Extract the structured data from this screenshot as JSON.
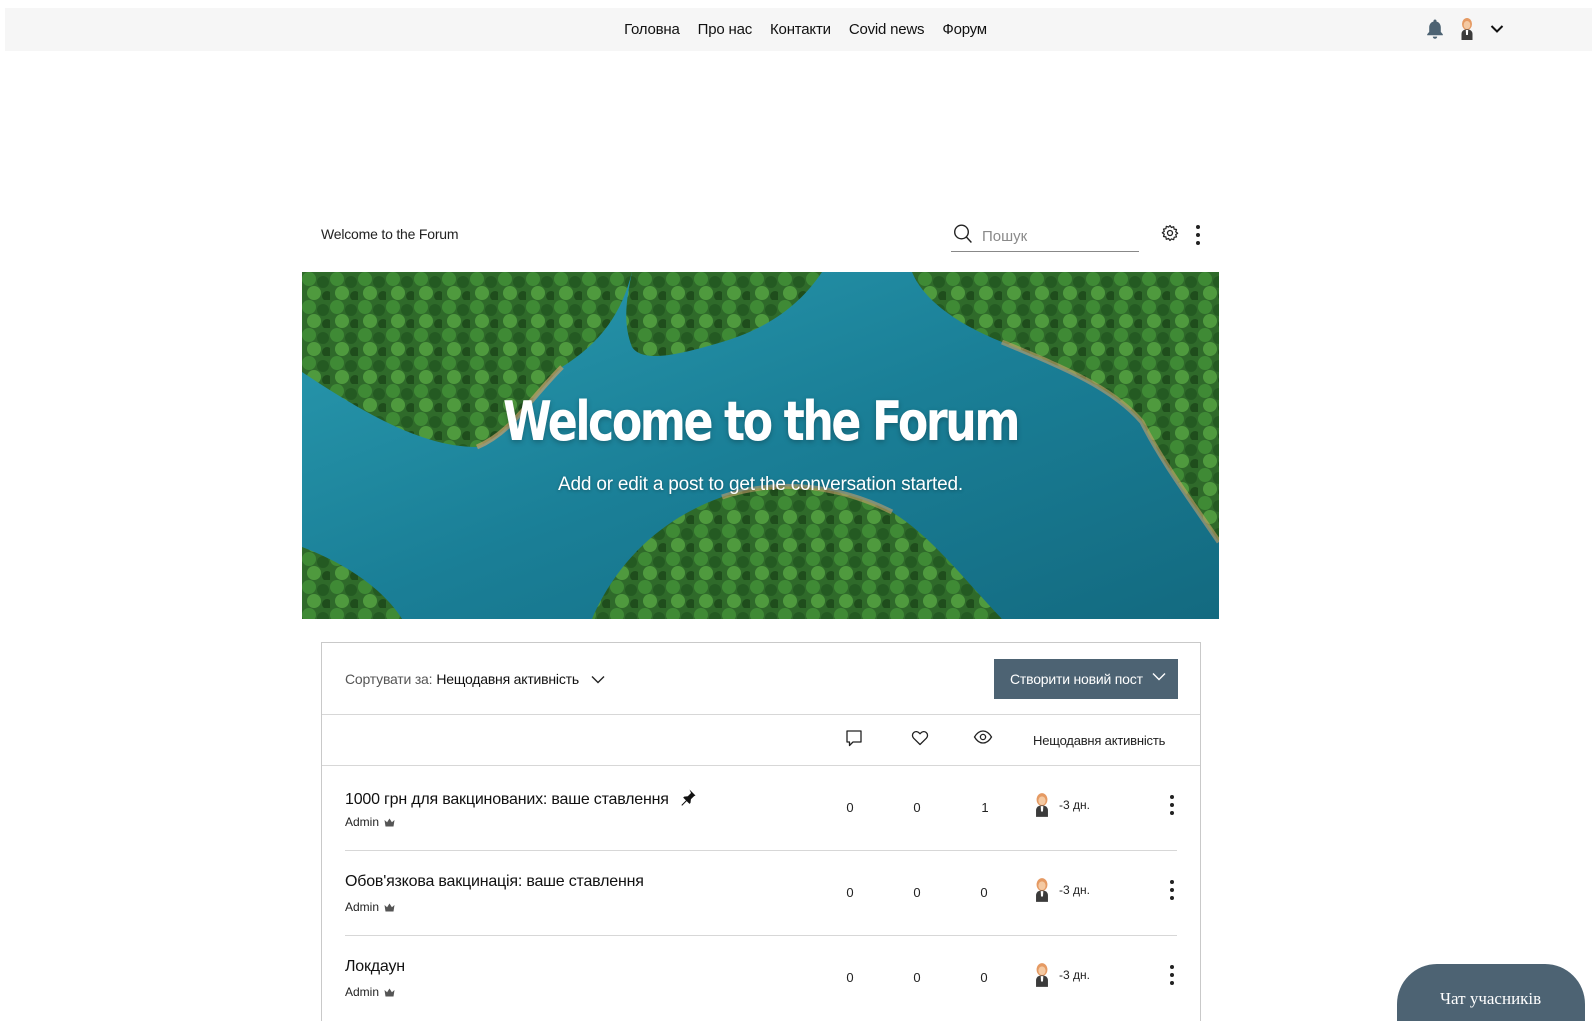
{
  "nav": {
    "items": [
      "Головна",
      "Про нас",
      "Контакти",
      "Covid news",
      "Форум"
    ],
    "icons": [
      "bell-icon",
      "user-avatar",
      "chevron-down-icon"
    ]
  },
  "forum": {
    "title": "Welcome to the Forum",
    "search_placeholder": "Пошук"
  },
  "hero": {
    "title": "Welcome to the Forum",
    "subtitle": "Add or edit a post to get the conversation started."
  },
  "toolbar": {
    "sort_label": "Сортувати за:",
    "sort_value": "Нещодавня активність",
    "create_label": "Створити новий пост"
  },
  "columns": {
    "icons": [
      "comment-icon",
      "heart-icon",
      "eye-icon"
    ],
    "activity_label": "Нещодавня активність"
  },
  "posts": [
    {
      "title": "1000 грн для вакцинованих: ваше ставлення",
      "pinned": true,
      "author": "Admin",
      "comments": "0",
      "likes": "0",
      "views": "1",
      "activity": "-3 дн."
    },
    {
      "title": "Обов'язкова вакцинація: ваше ставлення",
      "pinned": false,
      "author": "Admin",
      "comments": "0",
      "likes": "0",
      "views": "0",
      "activity": "-3 дн."
    },
    {
      "title": "Локдаун",
      "pinned": false,
      "author": "Admin",
      "comments": "0",
      "likes": "0",
      "views": "0",
      "activity": "-3 дн."
    }
  ],
  "chat": {
    "label": "Чат учасників"
  },
  "colors": {
    "accent": "#4d6373",
    "topbar": "#f6f6f6",
    "water": "#1a7f97",
    "forest": "#2f6a2a"
  }
}
